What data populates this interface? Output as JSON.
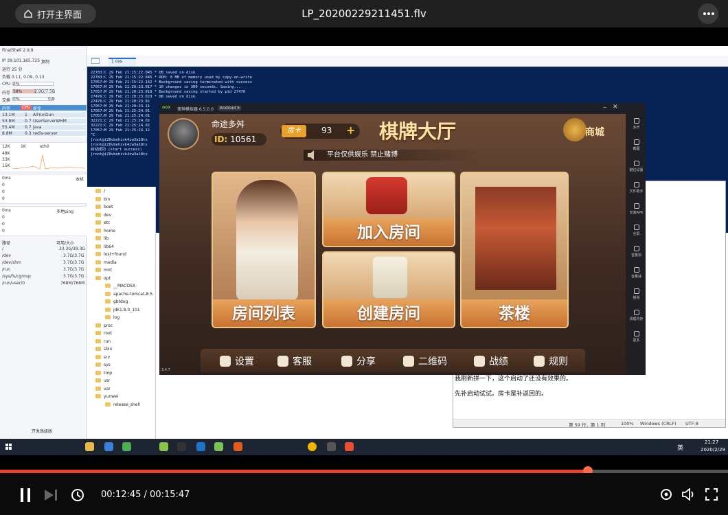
{
  "topbar": {
    "home_label": "打开主界面",
    "video_title": "LP_20200229211451.flv"
  },
  "finalshell": {
    "app_title": "FinalShell 2.9.8",
    "ip": "IP 39.101.165.725",
    "copy": "复制",
    "uptime": "运行 25 分",
    "load": "负载 0.11, 0.09, 0.13",
    "cpu_label": "CPU",
    "cpu_value": "2%",
    "mem_label": "内存",
    "mem_value": "58%",
    "mem_detail": "2.9G/7.5G",
    "swap_label": "交换",
    "swap_value": "0%",
    "swap_detail": "0/0",
    "proc_headers": [
      "内存",
      "CPU",
      "命令"
    ],
    "processes": [
      {
        "mem": "13.1M",
        "cpu": "1",
        "cmd": "AliYunDun"
      },
      {
        "mem": "53.8M",
        "cpu": "0.7",
        "cmd": "UserServerWHM"
      },
      {
        "mem": "55.4M",
        "cpu": "0.7",
        "cmd": "java"
      },
      {
        "mem": "8.8M",
        "cpu": "0.3",
        "cmd": "redis-server"
      }
    ],
    "net_up": "12K",
    "net_down": "1K",
    "net_iface": "eth0",
    "net_scale": [
      "48K",
      "33K",
      "15K"
    ],
    "ping_ms": "0ms",
    "ping_local": "本机",
    "ping_rows": [
      "0",
      "0",
      "0"
    ],
    "ping2_ms": "0ms",
    "ping2_label": "多地ping",
    "ping2_rows": [
      "0",
      "0",
      "0"
    ],
    "disk_headers": [
      "路径",
      "可用/大小"
    ],
    "disks": [
      {
        "path": "/",
        "size": "33.3G/39.3G"
      },
      {
        "path": "/dev",
        "size": "3.7G/3.7G"
      },
      {
        "path": "/dev/shm",
        "size": "3.7G/3.7G"
      },
      {
        "path": "/run",
        "size": "3.7G/3.7G"
      },
      {
        "path": "/sys/fs/cgroup",
        "size": "3.7G/3.7G"
      },
      {
        "path": "/run/user/0",
        "size": "768M/768M"
      }
    ],
    "footer": "开发高级版",
    "tab_label": "1 ces",
    "terminal_lines": [
      "22783:C 29 Feb 21:15:22.045 * DB saved on disk",
      "22783:C 29 Feb 21:15:22.045 * RDB: 8 MB of memory used by copy-on-write",
      "17057:M 29 Feb 21:15:22.142 * Background saving terminated with success",
      "17057:M 29 Feb 21:20:23.017 * 10 changes in 300 seconds. Saving...",
      "17057:M 29 Feb 21:20:23.018 * Background saving started by pid 27476",
      "27476:C 29 Feb 21:20:23.023 * DB saved on disk",
      "27476:C 29 Feb 21:20:23.02",
      "17057:M 29 Feb 21:20:23.11",
      "17057:M 29 Feb 21:25:24.01",
      "17057:M 29 Feb 21:25:24.01",
      "32221:C 29 Feb 21:25:24.02",
      "32221:C 29 Feb 21:25:24.02",
      "17057:M 29 Feb 21:25:24.12",
      "^C",
      "[root@iZ8vbehivk4zw3a18tx",
      "[root@iZ8vbehivk4zw3a18tx",
      "启动成功 (start success)",
      "[root@iZ8vbehivk4zw3a18tx"
    ],
    "tree": [
      "/",
      "bin",
      "boot",
      "dev",
      "etc",
      "home",
      "lib",
      "lib64",
      "lost+found",
      "media",
      "mnt",
      "opt",
      "__MACOSX",
      "apache-tomcat-8.5.",
      "gbtdog",
      "jdk1.8.0_101",
      "log",
      "proc",
      "root",
      "run",
      "sbin",
      "srv",
      "sys",
      "tmp",
      "usr",
      "var",
      "yunwei",
      "release_shell"
    ]
  },
  "notepad": {
    "line1": "我刷新拼一下，这个启动了还没有效果的。",
    "line2": "先补启动试试。房卡是补返回的。",
    "status_pos": "第 59 行，第 1 列",
    "status_zoom": "100%",
    "status_eol": "Windows (CRLF)",
    "status_enc": "UTF-8"
  },
  "emulator": {
    "title": "夜神模拟器 6.5.0.0",
    "android": "Android 5",
    "version": "3.4.7",
    "side_items": [
      "多开",
      "截图",
      "键位设置",
      "文件助手",
      "安装APK",
      "全屏",
      "音量加",
      "音量减",
      "摇晃",
      "清理内存",
      "更多"
    ]
  },
  "game": {
    "player_name": "命途多舛",
    "player_id": "10561",
    "id_label": "ID:",
    "room_card_label": "房卡",
    "room_card_count": "93",
    "hall_title": "棋牌大厅",
    "shop_label": "商城",
    "notice": "平台仅供娱乐 禁止赌博",
    "btn_room_list": "房间列表",
    "btn_join_room": "加入房间",
    "btn_create_room": "创建房间",
    "btn_teahouse": "茶楼",
    "menu": [
      "设置",
      "客服",
      "分享",
      "二维码",
      "战绩",
      "规则"
    ]
  },
  "taskbar": {
    "time": "21:27",
    "date": "2020/2/29",
    "ime": "英"
  },
  "player": {
    "current_time": "00:12:45",
    "separator": " / ",
    "duration": "00:15:47",
    "progress": 0.808
  },
  "colors": {
    "progress_played": "#e8452d",
    "terminal_bg": "#072356",
    "accent": "#1e73c8"
  }
}
